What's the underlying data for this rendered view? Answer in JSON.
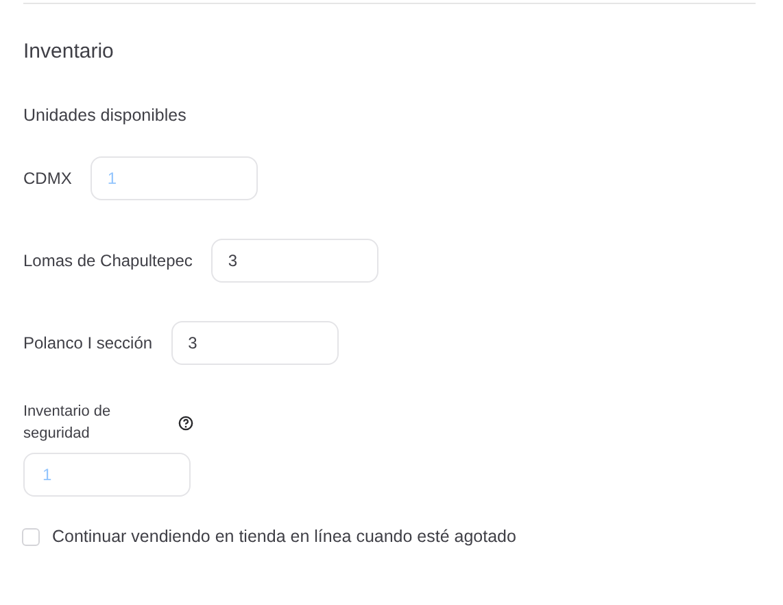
{
  "section": {
    "title": "Inventario",
    "subtitle": "Unidades disponibles"
  },
  "locations": [
    {
      "label": "CDMX",
      "placeholder": "1"
    },
    {
      "label": "Lomas de Chapultepec",
      "value": "3"
    },
    {
      "label": "Polanco I sección",
      "value": "3"
    }
  ],
  "safety_stock": {
    "label": "Inventario de seguridad",
    "placeholder": "1"
  },
  "continue_selling": {
    "label": "Continuar vendiendo en tienda en línea cuando esté agotado",
    "checked": false
  }
}
